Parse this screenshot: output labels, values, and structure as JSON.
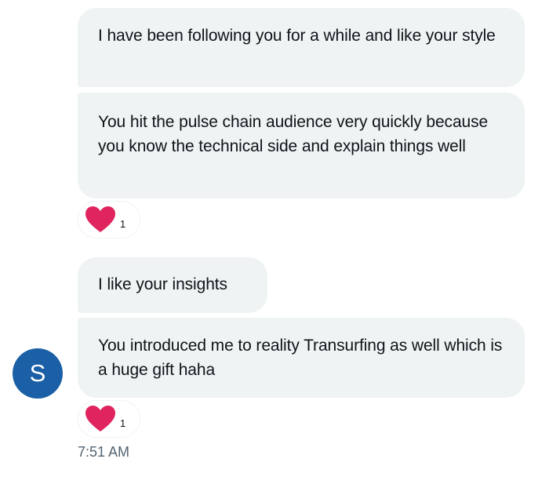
{
  "conversation": {
    "messages": [
      {
        "text": "I have been following you for a while and like your style"
      },
      {
        "text": "You hit the pulse chain audience very quickly because you know the technical side and explain things well",
        "reaction": {
          "icon": "heart-icon",
          "count": "1"
        }
      },
      {
        "text": "I like your insights"
      },
      {
        "text": "You introduced me to reality Transurfing as well which is a huge gift haha",
        "reaction": {
          "icon": "heart-icon",
          "count": "1"
        }
      }
    ],
    "sender": {
      "avatar_initial": "S",
      "avatar_color": "#1b5fa6"
    },
    "timestamp": "7:51 AM"
  },
  "colors": {
    "bubble_bg": "#eff3f4",
    "text": "#0f1419",
    "timestamp": "#536471",
    "heart": "#e0245e"
  }
}
